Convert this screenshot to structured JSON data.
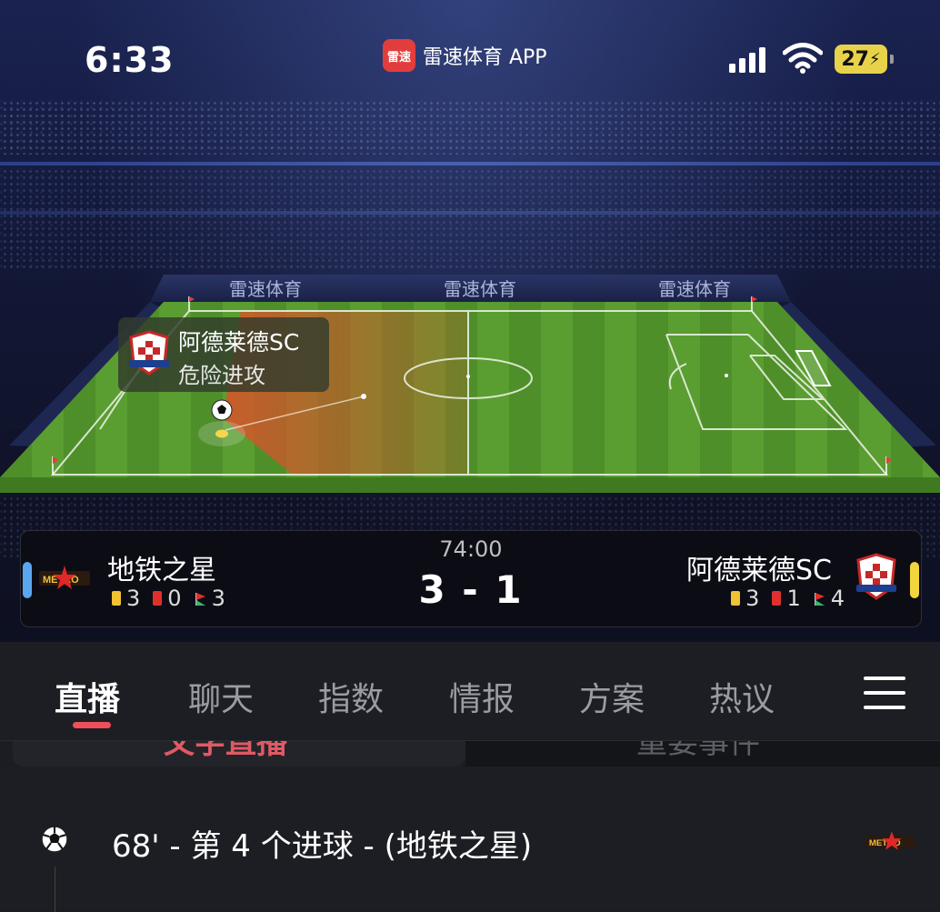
{
  "status_bar": {
    "time": "6:33",
    "app_icon_text": "雷速",
    "app_name": "雷速体育 APP",
    "battery": "27"
  },
  "pitch": {
    "ad_board_text": "雷速体育",
    "event": {
      "team": "阿德莱德SC",
      "type": "危险进攻"
    }
  },
  "scoreboard": {
    "match_time": "74:00",
    "score": "3 - 1",
    "home": {
      "name": "地铁之星",
      "yellow_cards": "3",
      "red_cards": "0",
      "corners": "3",
      "color": "#5aa6ef"
    },
    "away": {
      "name": "阿德莱德SC",
      "yellow_cards": "3",
      "red_cards": "1",
      "corners": "4",
      "color": "#f2d53c"
    }
  },
  "tabs": [
    {
      "label": "直播",
      "active": true
    },
    {
      "label": "聊天"
    },
    {
      "label": "指数"
    },
    {
      "label": "情报"
    },
    {
      "label": "方案"
    },
    {
      "label": "热议"
    }
  ],
  "subtabs": {
    "left": "文字直播",
    "right": "重要事件"
  },
  "feed": [
    {
      "text": "68' - 第 4 个进球 - (地铁之星)",
      "icon": "soccer-ball-icon"
    }
  ],
  "colors": {
    "accent": "#ef4e5a",
    "pitch_green": "#4e8f2a",
    "attack_zone": "#d4552a"
  }
}
